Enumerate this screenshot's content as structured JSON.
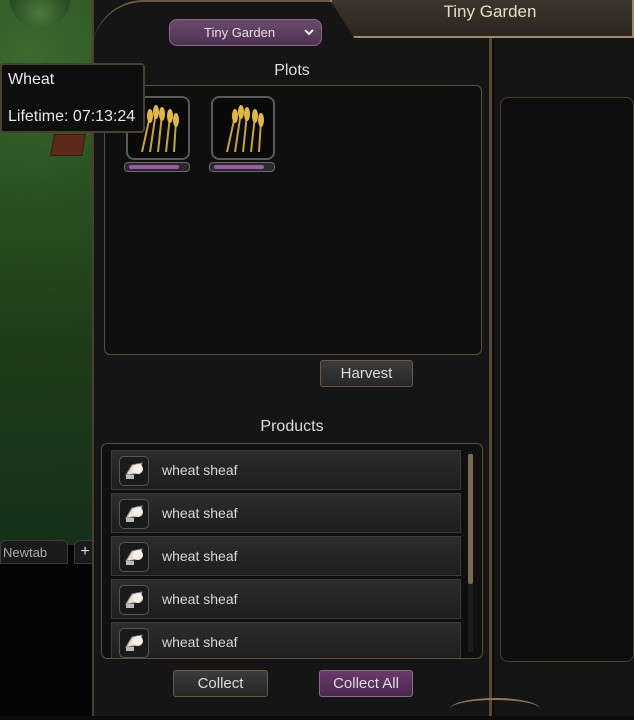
{
  "window": {
    "title": "Tiny Garden"
  },
  "dropdown": {
    "selected": "Tiny Garden"
  },
  "tooltip": {
    "name": "Wheat",
    "lifetime": "Lifetime: 07:13:24"
  },
  "plots": {
    "label": "Plots",
    "items": [
      {
        "crop": "wheat",
        "icon": "wheat-icon",
        "progress": 0.9
      },
      {
        "crop": "wheat",
        "icon": "wheat-icon",
        "progress": 0.9
      }
    ]
  },
  "harvest_button": "Harvest",
  "products": {
    "label": "Products",
    "items": [
      {
        "name": "wheat sheaf",
        "icon": "sheaf-icon"
      },
      {
        "name": "wheat sheaf",
        "icon": "sheaf-icon"
      },
      {
        "name": "wheat sheaf",
        "icon": "sheaf-icon"
      },
      {
        "name": "wheat sheaf",
        "icon": "sheaf-icon"
      },
      {
        "name": "wheat sheaf",
        "icon": "sheaf-icon"
      }
    ]
  },
  "collect_button": "Collect",
  "collect_all_button": "Collect All",
  "chat_tabs": {
    "tab": "Newtab",
    "add": "+"
  },
  "colors": {
    "accent_purple": "#6a3a6c",
    "frame_bronze": "#6a5a44"
  }
}
